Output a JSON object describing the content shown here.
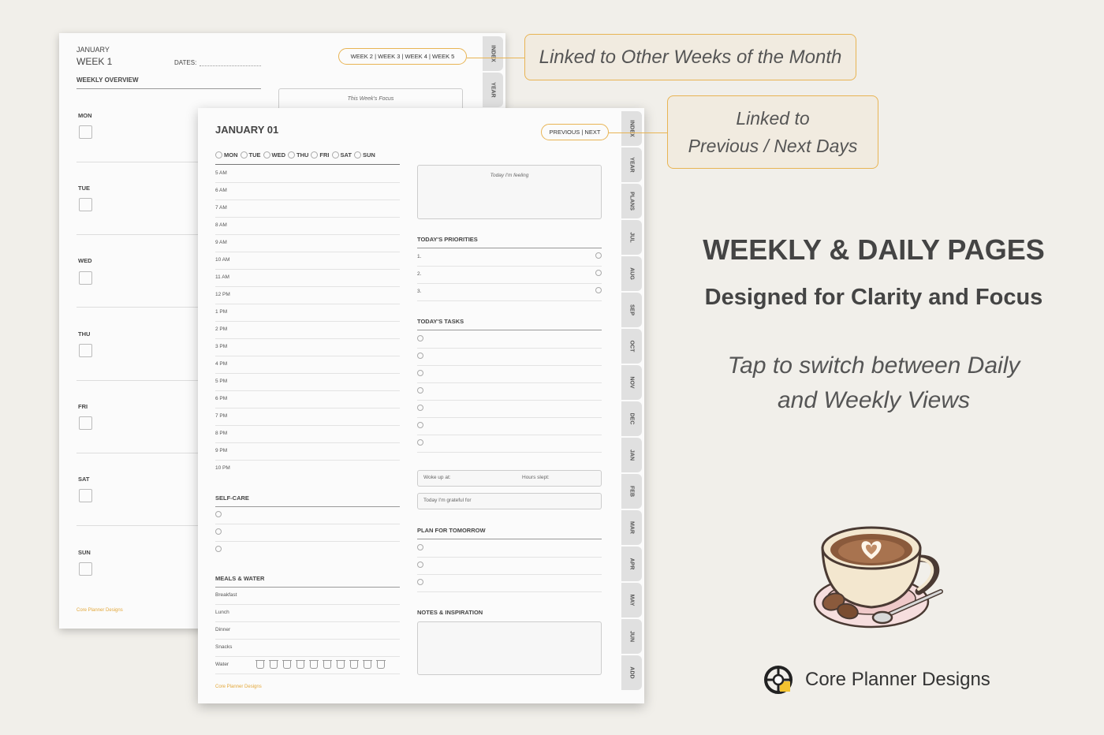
{
  "weekly_page": {
    "month": "JANUARY",
    "title": "WEEK 1",
    "dates_label": "DATES:",
    "overview_label": "WEEKLY OVERVIEW",
    "week_links": "WEEK 2  |  WEEK 3  |  WEEK 4  |  WEEK 5",
    "focus_label": "This Week's Focus",
    "days": [
      "MON",
      "TUE",
      "WED",
      "THU",
      "FRI",
      "SAT",
      "SUN"
    ],
    "footer": "Core Planner Designs",
    "tabs": [
      "INDEX",
      "YEAR"
    ]
  },
  "daily_page": {
    "title": "JANUARY 01",
    "nav": "PREVIOUS  |  NEXT",
    "days": [
      "MON",
      "TUE",
      "WED",
      "THU",
      "FRI",
      "SAT",
      "SUN"
    ],
    "hours": [
      "5 AM",
      "6 AM",
      "7 AM",
      "8 AM",
      "9 AM",
      "10 AM",
      "11 AM",
      "12 PM",
      "1 PM",
      "2 PM",
      "3 PM",
      "4 PM",
      "5 PM",
      "6 PM",
      "7 PM",
      "8 PM",
      "9 PM",
      "10 PM"
    ],
    "self_care_label": "SELF-CARE",
    "meals_label": "MEALS & WATER",
    "meals": [
      "Breakfast",
      "Lunch",
      "Dinner",
      "Snacks",
      "Water"
    ],
    "water_cups": 10,
    "feeling_label": "Today I'm feeling",
    "priorities_label": "TODAY'S PRIORITIES",
    "priorities": [
      "1.",
      "2.",
      "3."
    ],
    "tasks_label": "TODAY'S TASKS",
    "woke_label": "Woke up at:",
    "slept_label": "Hours slept:",
    "grateful_label": "Today I'm grateful for",
    "plan_label": "PLAN FOR TOMORROW",
    "notes_label": "NOTES & INSPIRATION",
    "footer": "Core Planner Designs",
    "tabs": [
      "INDEX",
      "YEAR",
      "PLANS",
      "JUL",
      "AUG",
      "SEP",
      "OCT",
      "NOV",
      "DEC",
      "JAN",
      "FEB",
      "MAR",
      "APR",
      "MAY",
      "JUN",
      "ADD"
    ]
  },
  "callouts": {
    "weeks": "Linked to Other Weeks of the Month",
    "days_line1": "Linked to",
    "days_line2": "Previous / Next Days"
  },
  "marketing": {
    "headline": "WEEKLY & DAILY PAGES",
    "subhead": "Designed for Clarity and Focus",
    "tagline_line1": "Tap to switch between Daily",
    "tagline_line2": "and Weekly Views"
  },
  "brand": {
    "name": "Core Planner Designs",
    "icon": "crosshair-logo-icon"
  },
  "colors": {
    "accent": "#e8b454",
    "background": "#f1efea",
    "text": "#444444"
  }
}
